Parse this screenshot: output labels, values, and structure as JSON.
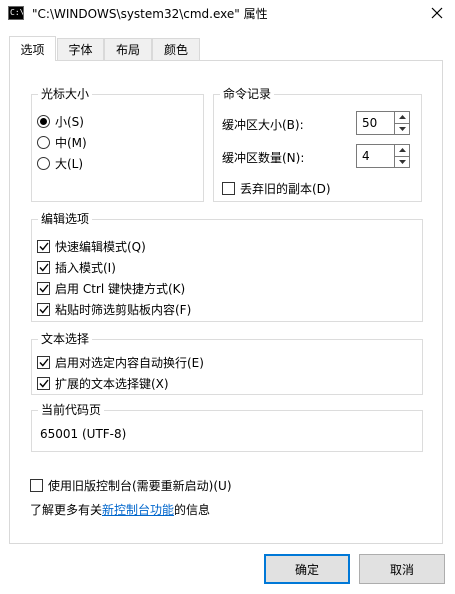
{
  "window": {
    "title": "\"C:\\WINDOWS\\system32\\cmd.exe\" 属性",
    "app_icon_text": "C:\\",
    "close_icon": "close-icon"
  },
  "tabs": [
    {
      "label": "选项",
      "active": true
    },
    {
      "label": "字体",
      "active": false
    },
    {
      "label": "布局",
      "active": false
    },
    {
      "label": "颜色",
      "active": false
    }
  ],
  "cursor_size": {
    "title": "光标大小",
    "options": [
      {
        "label": "小(S)",
        "selected": true
      },
      {
        "label": "中(M)",
        "selected": false
      },
      {
        "label": "大(L)",
        "selected": false
      }
    ]
  },
  "command_history": {
    "title": "命令记录",
    "buffer_size_label": "缓冲区大小(B):",
    "buffer_size_value": "50",
    "buffer_count_label": "缓冲区数量(N):",
    "buffer_count_value": "4",
    "discard_label": "丢弃旧的副本(D)",
    "discard_checked": false
  },
  "edit_options": {
    "title": "编辑选项",
    "items": [
      {
        "label": "快速编辑模式(Q)",
        "checked": true
      },
      {
        "label": "插入模式(I)",
        "checked": true
      },
      {
        "label": "启用 Ctrl 键快捷方式(K)",
        "checked": true
      },
      {
        "label": "粘贴时筛选剪贴板内容(F)",
        "checked": true
      }
    ]
  },
  "text_selection": {
    "title": "文本选择",
    "items": [
      {
        "label": "启用对选定内容自动换行(E)",
        "checked": true
      },
      {
        "label": "扩展的文本选择键(X)",
        "checked": true
      }
    ]
  },
  "code_page": {
    "title": "当前代码页",
    "value": "65001 (UTF-8)"
  },
  "legacy": {
    "label": "使用旧版控制台(需要重新启动)(U)",
    "checked": false
  },
  "learn_more": {
    "prefix": "了解更多有关",
    "link": "新控制台功能",
    "suffix": "的信息"
  },
  "buttons": {
    "ok": "确定",
    "cancel": "取消"
  },
  "colors": {
    "accent": "#0078d7",
    "link": "#0066cc",
    "border": "#dcdcdc"
  }
}
